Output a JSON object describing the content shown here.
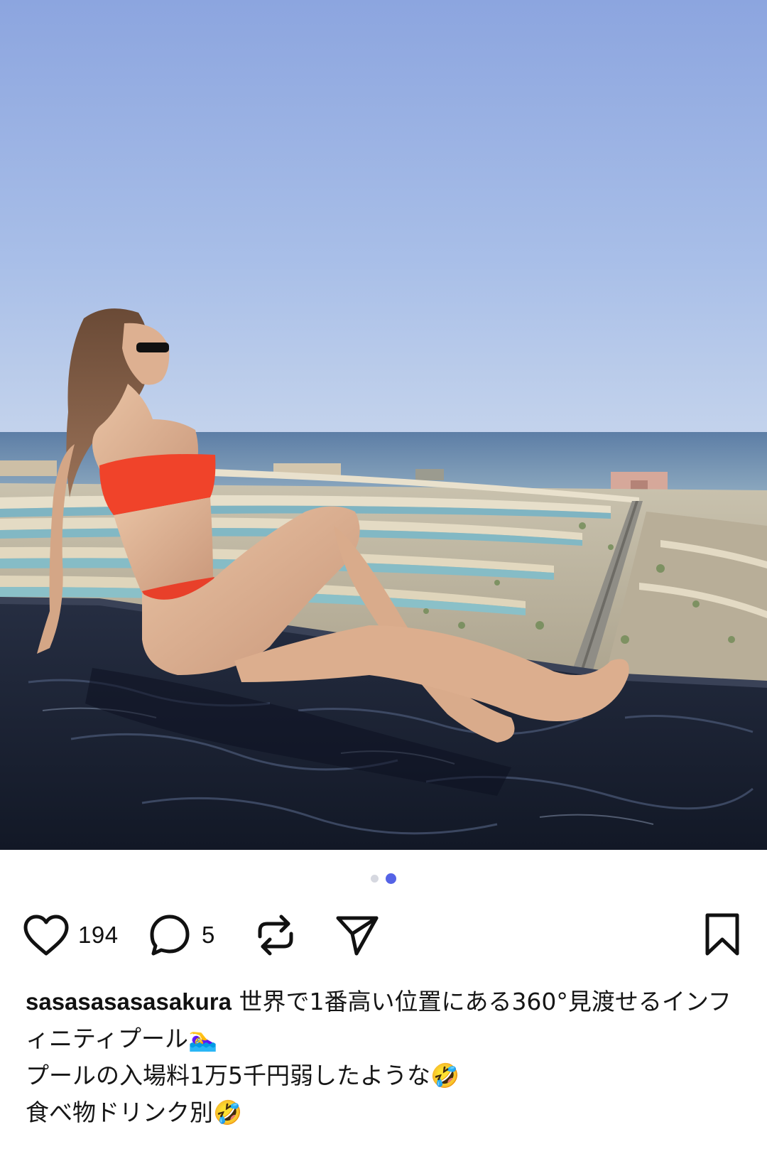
{
  "post": {
    "carousel": {
      "total": 2,
      "active_index": 1
    },
    "actions": {
      "like_count": "194",
      "comment_count": "5"
    },
    "caption": {
      "username": "sasasasasasakura",
      "text": " 世界で1番高い位置にある360°見渡せるインフィニティプール🏊‍♀️\nプールの入場料1万5千円弱したような🤣\n食べ物ドリンク別🤣"
    }
  },
  "icons": {
    "like": "heart-icon",
    "comment": "comment-bubble-icon",
    "repost": "repost-arrows-icon",
    "share": "send-paper-plane-icon",
    "bookmark": "bookmark-icon"
  },
  "colors": {
    "sky_top": "#8EA7E0",
    "sky_bottom": "#BFD0EC",
    "sea": "#6F8FB0",
    "pool": "#1B2233",
    "swimsuit": "#F0432A",
    "dot_active": "#5563E6",
    "dot_inactive": "#D6D8E0"
  }
}
